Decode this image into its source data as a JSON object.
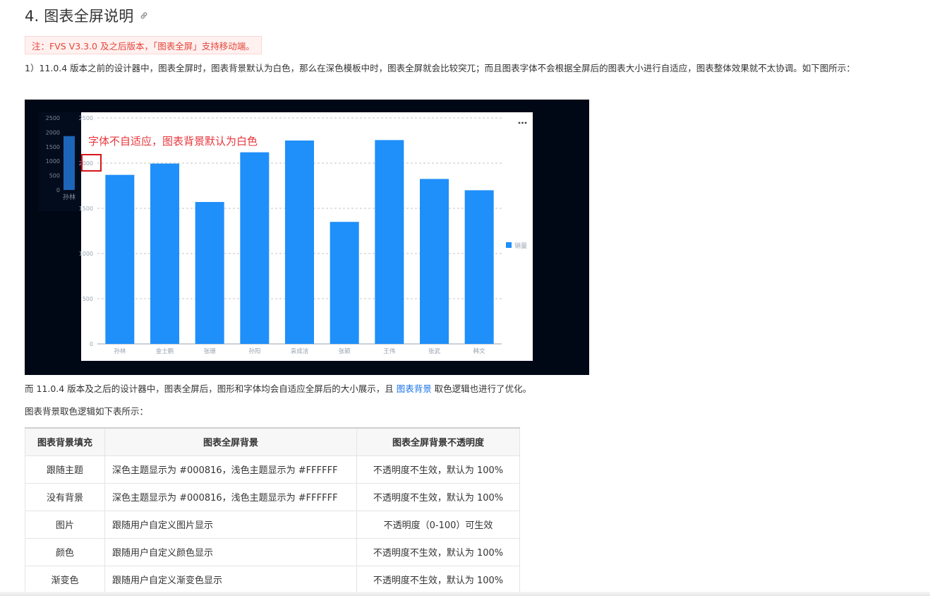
{
  "heading": {
    "title": "4. 图表全屏说明",
    "anchor_icon": "link-icon"
  },
  "notice": {
    "text": "注：FVS V3.3.0 及之后版本，「图表全屏」支持移动端。"
  },
  "para1": {
    "text": "1）11.0.4 版本之前的设计器中，图表全屏时，图表背景默认为白色，那么在深色模板中时，图表全屏就会比较突兀；而且图表字体不会根据全屏后的图表大小进行自适应，图表整体效果就不太协调。如下图所示："
  },
  "figure": {
    "annotation": "字体不自适应，图表背景默认为白色",
    "menu_icon": "more-dots-icon",
    "colors": {
      "bar": "#1f8ff9",
      "dark_bg": "#000816",
      "annotation": "#e8373d",
      "highlight_box": "#d7151b"
    }
  },
  "chart_data": [
    {
      "type": "bar",
      "categories": [
        "孙林",
        "金士鹏",
        "张珊",
        "孙阳",
        "袁成洁",
        "张颖",
        "王伟",
        "张武",
        "韩文"
      ],
      "series": [
        {
          "name": "销量",
          "values": [
            1870,
            1995,
            1570,
            2120,
            2250,
            1350,
            2255,
            1825,
            1700
          ]
        }
      ],
      "ylim": [
        0,
        2500
      ],
      "yticks": [
        0,
        500,
        1000,
        1500,
        2000,
        2500
      ],
      "grid": true,
      "legend": "right"
    },
    {
      "type": "bar",
      "categories": [
        "孙林"
      ],
      "values": [
        1870
      ],
      "ylim": [
        0,
        2500
      ],
      "yticks": [
        0,
        500,
        1000,
        1500,
        2000,
        2500
      ]
    }
  ],
  "para2": {
    "before": "而 11.0.4 版本及之后的设计器中，图表全屏后，图形和字体均会自适应全屏后的大小展示，且 ",
    "link": "图表背景",
    "after": " 取色逻辑也进行了优化。"
  },
  "para3": {
    "text": "图表背景取色逻辑如下表所示："
  },
  "table": {
    "headers": [
      "图表背景填充",
      "图表全屏背景",
      "图表全屏背景不透明度"
    ],
    "rows": [
      [
        "跟随主题",
        "深色主题显示为 #000816，浅色主题显示为 #FFFFFF",
        "不透明度不生效，默认为 100%"
      ],
      [
        "没有背景",
        "深色主题显示为 #000816，浅色主题显示为 #FFFFFF",
        "不透明度不生效，默认为 100%"
      ],
      [
        "图片",
        "跟随用户自定义图片显示",
        "不透明度（0-100）可生效"
      ],
      [
        "颜色",
        "跟随用户自定义颜色显示",
        "不透明度不生效，默认为 100%"
      ],
      [
        "渐变色",
        "跟随用户自定义渐变色显示",
        "不透明度不生效，默认为 100%"
      ]
    ]
  }
}
